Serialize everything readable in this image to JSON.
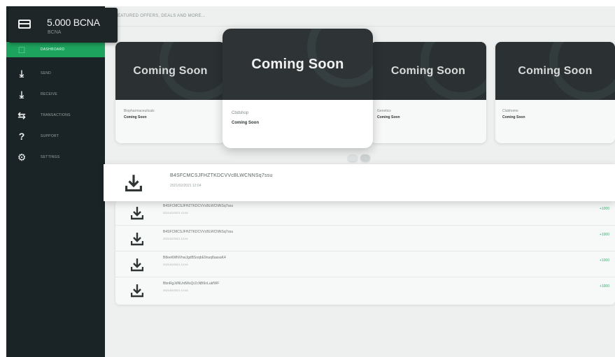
{
  "wallet": {
    "amount": "5.000 BCNA",
    "sub": "BCNA"
  },
  "sidebar": {
    "items": [
      {
        "label": "DASHBOARD",
        "icon": "dashboard-icon",
        "active": true
      },
      {
        "label": "SEND",
        "icon": "send-icon",
        "active": false
      },
      {
        "label": "RECEIVE",
        "icon": "receive-icon",
        "active": false
      },
      {
        "label": "TRANSACTIONS",
        "icon": "transactions-icon",
        "active": false
      },
      {
        "label": "SUPPORT",
        "icon": "support-icon",
        "active": false
      },
      {
        "label": "SETTINGS",
        "icon": "settings-icon",
        "active": false
      }
    ]
  },
  "header": {
    "featured": "FEATURED OFFERS, DEALS AND MORE..."
  },
  "offers": [
    {
      "banner": "Coming Soon",
      "name": "Biopharmaceuticals",
      "status": "Coming Soon"
    },
    {
      "banner": "Coming Soon",
      "name": "Cbdshop",
      "status": "Coming Soon"
    },
    {
      "banner": "Coming Soon",
      "name": "Genetics",
      "status": "Coming Soon"
    },
    {
      "banner": "Coming Soon",
      "name": "Clubhome",
      "status": "Coming Soon"
    }
  ],
  "highlight": {
    "hash": "B4SFCMCSJFHZTKDCVVcBLWCNNSq7ssu",
    "date": "2021/02/2021 12:04"
  },
  "transactions": [
    {
      "hash": "B4SFCMCSJFHZTKDCVVcBLWCNNSq7ssu",
      "date": "2021/02/2021 12:04",
      "amount": "+1000"
    },
    {
      "hash": "B4SFCMCSJFHZTKDCVVcBLWCNNSq7ssu",
      "date": "2021/02/2021 12:04",
      "amount": "+1000"
    },
    {
      "hash": "B8eeKMNVhwJgdBSoqbE9nuq8aasaK4",
      "date": "2021/02/2021 12:04",
      "amount": "+1000"
    },
    {
      "hash": "BbnRgJdNUrdWsQrZcNB6nLukfWF",
      "date": "2021/02/2021 12:04",
      "amount": "+1000"
    }
  ],
  "colors": {
    "sidebar_bg": "#1a2426",
    "accent_green": "#1ea35e",
    "banner_dark": "#2b3133"
  }
}
